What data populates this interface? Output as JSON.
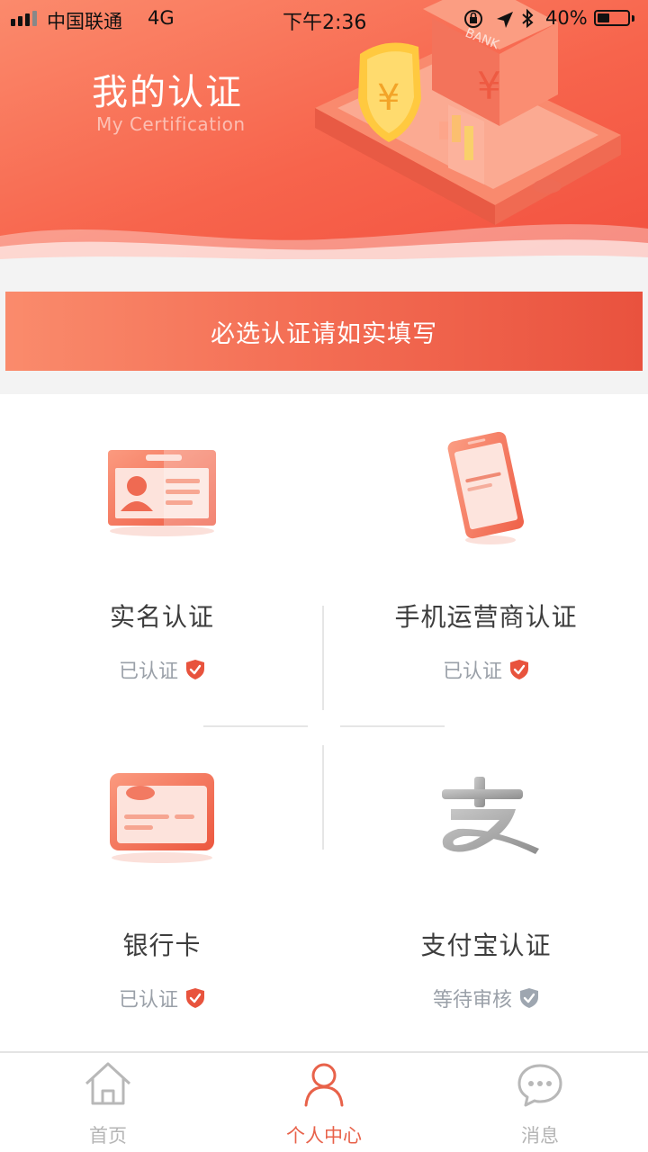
{
  "status_bar": {
    "carrier": "中国联通",
    "network": "4G",
    "time": "下午2:36",
    "battery_percent": "40%",
    "battery_level": 0.4
  },
  "hero": {
    "title": "我的认证",
    "subtitle": "My Certification",
    "illustration_label": "BANK",
    "currency_symbol": "¥"
  },
  "notice": {
    "text": "必选认证请如实填写"
  },
  "certifications": [
    {
      "title": "实名认证",
      "status": "已认证",
      "icon": "id-card-icon",
      "status_icon": "verified-shield-icon",
      "verified": true
    },
    {
      "title": "手机运营商认证",
      "status": "已认证",
      "icon": "mobile-phone-icon",
      "status_icon": "verified-shield-icon",
      "verified": true
    },
    {
      "title": "银行卡",
      "status": "已认证",
      "icon": "bank-card-icon",
      "status_icon": "verified-shield-icon",
      "verified": true
    },
    {
      "title": "支付宝认证",
      "status": "等待审核",
      "icon": "alipay-icon",
      "status_icon": "pending-shield-icon",
      "verified": false
    }
  ],
  "tab_bar": {
    "tabs": [
      {
        "label": "首页",
        "icon": "home-icon",
        "active": false
      },
      {
        "label": "个人中心",
        "icon": "user-icon",
        "active": true
      },
      {
        "label": "消息",
        "icon": "message-icon",
        "active": false
      }
    ]
  },
  "colors": {
    "accent": "#e8624a",
    "verified_shield": "#e8533d",
    "pending_shield": "#9ea6b0",
    "status_text": "#9aa0a8"
  }
}
